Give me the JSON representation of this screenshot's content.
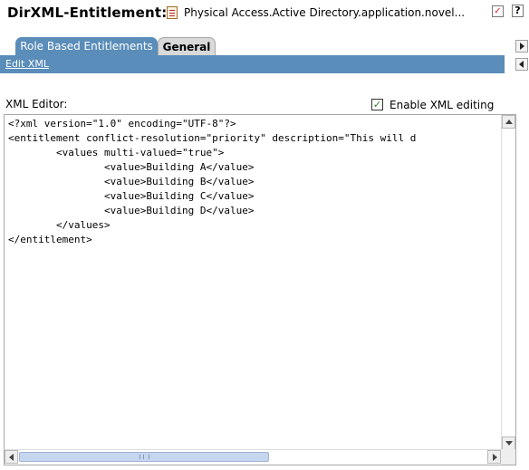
{
  "header": {
    "title": "DirXML-Entitlement:",
    "object_name": "Physical Access.Active Directory.application.novel...",
    "help_label": "?"
  },
  "tabs": [
    {
      "label": "Role Based Entitlements",
      "active": true
    },
    {
      "label": "General",
      "active": false
    }
  ],
  "subnav": {
    "edit_xml": "Edit XML"
  },
  "editor": {
    "label": "XML Editor:",
    "enable_label": "Enable XML editing",
    "enable_checked": true,
    "check_mark": "✓",
    "code": "<?xml version=\"1.0\" encoding=\"UTF-8\"?>\n<entitlement conflict-resolution=\"priority\" description=\"This will d\n\t<values multi-valued=\"true\">\n\t\t<value>Building A</value>\n\t\t<value>Building B</value>\n\t\t<value>Building C</value>\n\t\t<value>Building D</value>\n\t</values>\n</entitlement>"
  },
  "colors": {
    "tab_band": "#5a8db9",
    "scroll_thumb": "#c6d6ef"
  }
}
